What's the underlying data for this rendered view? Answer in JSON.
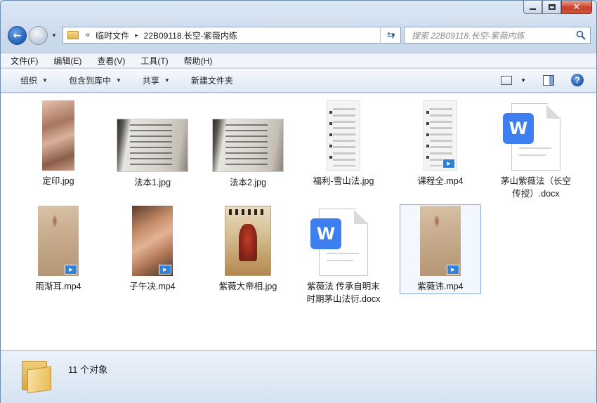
{
  "nav": {
    "breadcrumbs_prefix": "«",
    "crumb1": "临时文件",
    "crumb_sep": "▸",
    "crumb2": "22B09118.长空-紫薇内练",
    "search_placeholder": "搜索 22B09118.长空-紫薇内练"
  },
  "menu": [
    "文件(F)",
    "编辑(E)",
    "查看(V)",
    "工具(T)",
    "帮助(H)"
  ],
  "toolbar": {
    "organize": "组织",
    "include": "包含到库中",
    "share": "共享",
    "new_folder": "新建文件夹"
  },
  "files": [
    {
      "name": "定印.jpg",
      "kind": "photo-hand"
    },
    {
      "name": "法本1.jpg",
      "kind": "photo-doc"
    },
    {
      "name": "法本2.jpg",
      "kind": "photo-doc"
    },
    {
      "name": "福利-雪山法.jpg",
      "kind": "phone-shot"
    },
    {
      "name": "课程全.mp4",
      "kind": "phone-video"
    },
    {
      "name": "茅山紫薇法（长空传授）.docx",
      "kind": "docx"
    },
    {
      "name": "雨渐耳.mp4",
      "kind": "video-wall"
    },
    {
      "name": "子午决.mp4",
      "kind": "hands-video"
    },
    {
      "name": "紫薇大帝相.jpg",
      "kind": "painting"
    },
    {
      "name": "紫薇法 传承自明末时期茅山法衍.docx",
      "kind": "docx"
    },
    {
      "name": "紫薇讳.mp4",
      "kind": "video-wall",
      "selected": true
    }
  ],
  "status": {
    "count": "11 个对象"
  }
}
